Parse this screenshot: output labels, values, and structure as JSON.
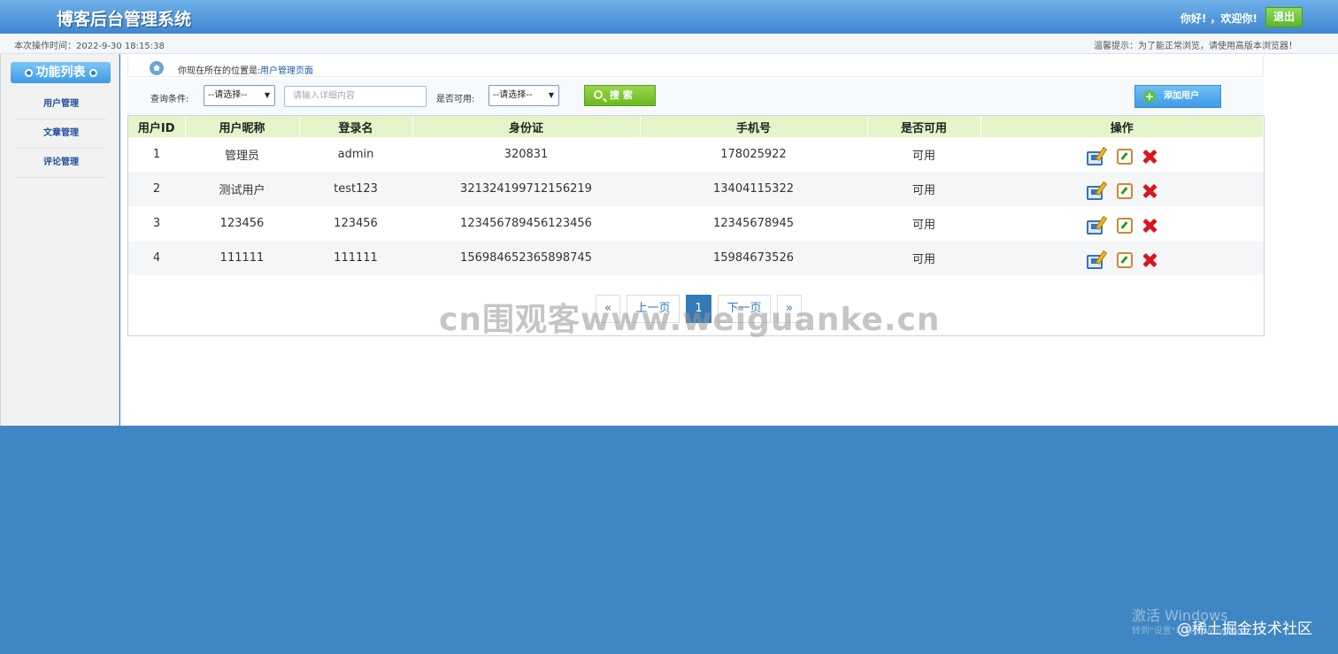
{
  "header": {
    "app_title": "博客后台管理系统",
    "greeting": "你好! ，欢迎你!",
    "logout_label": "退出"
  },
  "infobar": {
    "op_time": "本次操作时间：2022-9-30 18:15:38",
    "tip": "温馨提示：为了能正常浏览，请使用高版本浏览器！"
  },
  "sidebar": {
    "title": "功能列表",
    "items": [
      {
        "label": "用户管理"
      },
      {
        "label": "文章管理"
      },
      {
        "label": "评论管理"
      }
    ]
  },
  "breadcrumb": {
    "label": "你现在所在的位置是:",
    "current": "用户管理页面"
  },
  "filter": {
    "condition_label": "查询条件:",
    "condition_select": "--请选择--",
    "detail_placeholder": "请输入详细内容",
    "available_label": "是否可用:",
    "available_select": "--请选择--",
    "search_label": "搜 索",
    "add_user_label": "添加用户"
  },
  "table": {
    "headers": [
      "用户ID",
      "用户昵称",
      "登录名",
      "身份证",
      "手机号",
      "是否可用",
      "操作"
    ],
    "rows": [
      [
        "1",
        "管理员",
        "admin",
        "320831",
        "178025922",
        "可用"
      ],
      [
        "2",
        "测试用户",
        "test123",
        "321324199712156219",
        "13404115322",
        "可用"
      ],
      [
        "3",
        "123456",
        "123456",
        "123456789456123456",
        "12345678945",
        "可用"
      ],
      [
        "4",
        "111111",
        "111111",
        "156984652365898745",
        "15984673526",
        "可用"
      ]
    ]
  },
  "pager": {
    "first": "«",
    "prev": "上一页",
    "current": "1",
    "next": "下一页",
    "last": "»"
  },
  "overlay": {
    "watermark": "cn围观客www.weiguanke.cn",
    "windows_activate": "激活 Windows",
    "windows_sub": "转到\"设置\"以激活 Windows。",
    "juejin": "@稀土掘金技术社区"
  },
  "colors": {
    "header_blue": "#3f86d0",
    "page_bg": "#3f86c2",
    "table_header_green": "#e3f5c9",
    "logout_green": "#5ab52c",
    "delete_red": "#d9161d"
  }
}
